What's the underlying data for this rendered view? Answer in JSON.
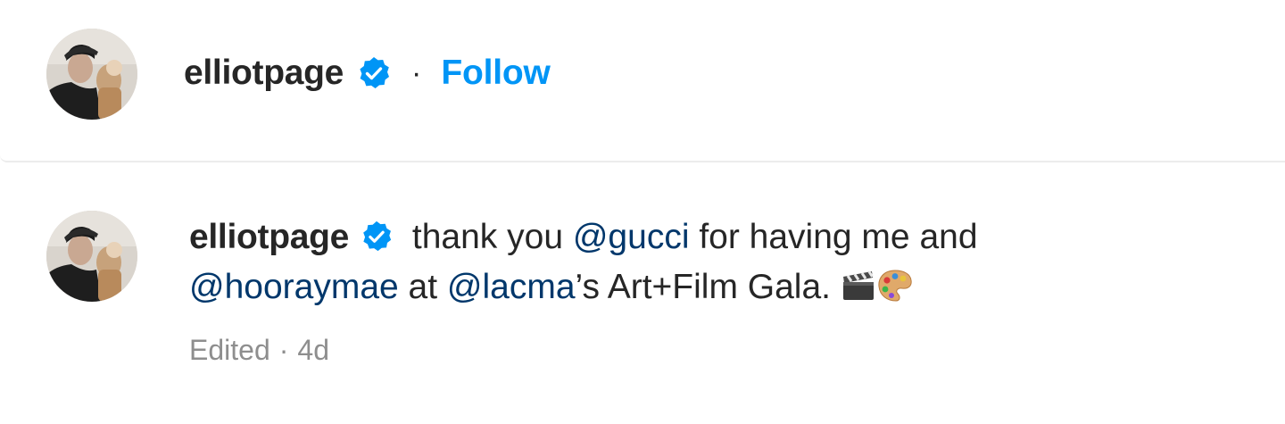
{
  "post_header": {
    "username": "elliotpage",
    "separator": "·",
    "follow_label": "Follow"
  },
  "caption": {
    "username": "elliotpage",
    "text_1": " thank you ",
    "mention_1": "@gucci",
    "text_2": " for having me and ",
    "mention_2": "@hooraymae",
    "text_3": " at ",
    "mention_3": "@lacma",
    "text_4": "’s Art+Film Gala. ",
    "emojis": [
      "clapperboard-icon",
      "artist-palette-icon"
    ]
  },
  "meta": {
    "edited_label": "Edited",
    "separator": "·",
    "time_ago": "4d"
  },
  "colors": {
    "follow_blue": "#0095f6",
    "mention_blue": "#00376b",
    "verified_blue": "#0095f6",
    "muted_gray": "#8e8e8e",
    "text_dark": "#262626"
  }
}
